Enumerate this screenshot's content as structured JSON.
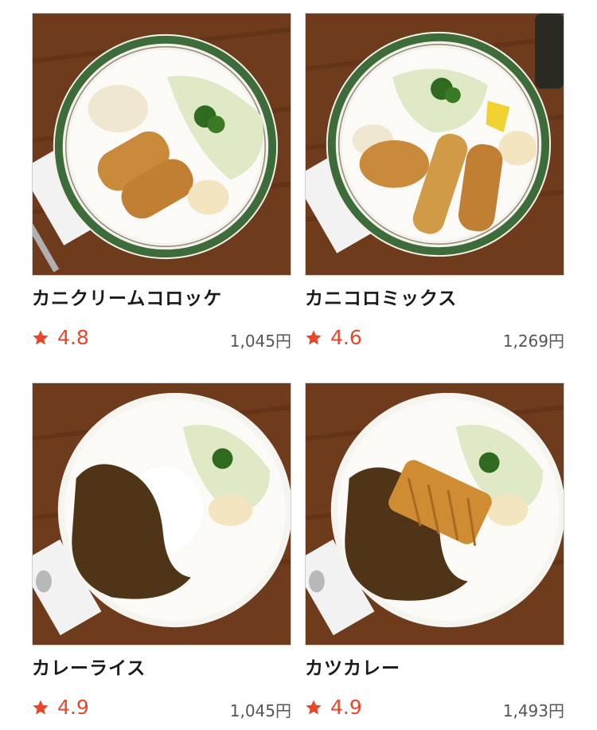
{
  "items": [
    {
      "name": "カニクリームコロッケ",
      "rating": "4.8",
      "price": "1,045円",
      "photo_icon": "crab-cream-croquette-plate"
    },
    {
      "name": "カニコロミックス",
      "rating": "4.6",
      "price": "1,269円",
      "photo_icon": "crab-croquette-mix-plate"
    },
    {
      "name": "カレーライス",
      "rating": "4.9",
      "price": "1,045円",
      "photo_icon": "curry-rice-plate"
    },
    {
      "name": "カツカレー",
      "rating": "4.9",
      "price": "1,493円",
      "photo_icon": "katsu-curry-plate"
    }
  ],
  "colors": {
    "accent": "#e8472a",
    "price_text": "#555555",
    "title_text": "#1a1a1a",
    "plate_rim_green": "#3d6b3a"
  }
}
